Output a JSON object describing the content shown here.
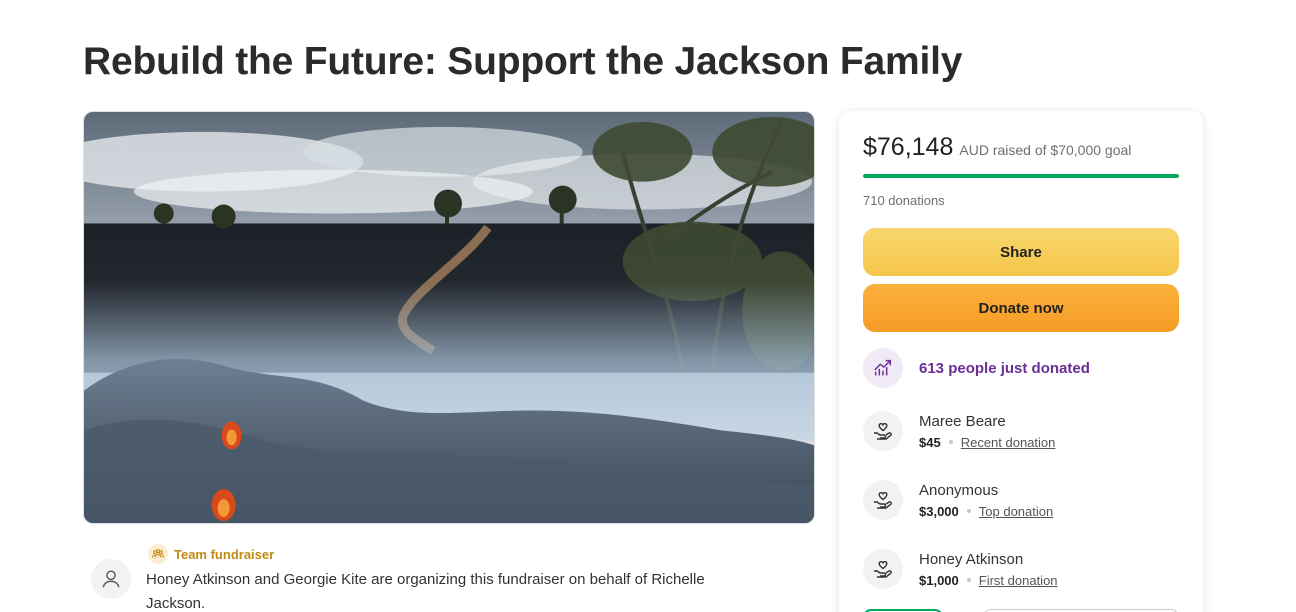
{
  "page": {
    "title": "Rebuild the Future: Support the Jackson Family"
  },
  "hero": {
    "alt_description": ""
  },
  "organizer": {
    "badge_label": "Team fundraiser",
    "text": "Honey Atkinson and Georgie Kite are organizing this fundraiser on behalf of Richelle Jackson.",
    "avatar_icon": "user-icon",
    "badge_icon": "team-icon"
  },
  "donation_card": {
    "amount_raised": "$76,148",
    "goal_text": "AUD raised of $70,000 goal",
    "progress_fraction": 1.0,
    "donations_count": "710 donations",
    "share_label": "Share",
    "donate_label": "Donate now",
    "trend_text": "613 people just donated",
    "trend_icon": "trending-up-icon",
    "colors": {
      "progress": "#02a95c",
      "trend": "#6b2e95",
      "share": "#f5c54a",
      "donate": "#f59c25"
    },
    "donors": [
      {
        "name": "Maree Beare",
        "amount": "$45",
        "tag": "Recent donation",
        "icon": "heart-hand-icon"
      },
      {
        "name": "Anonymous",
        "amount": "$3,000",
        "tag": "Top donation",
        "icon": "heart-hand-icon"
      },
      {
        "name": "Honey Atkinson",
        "amount": "$1,000",
        "tag": "First donation",
        "icon": "heart-hand-icon"
      }
    ]
  }
}
